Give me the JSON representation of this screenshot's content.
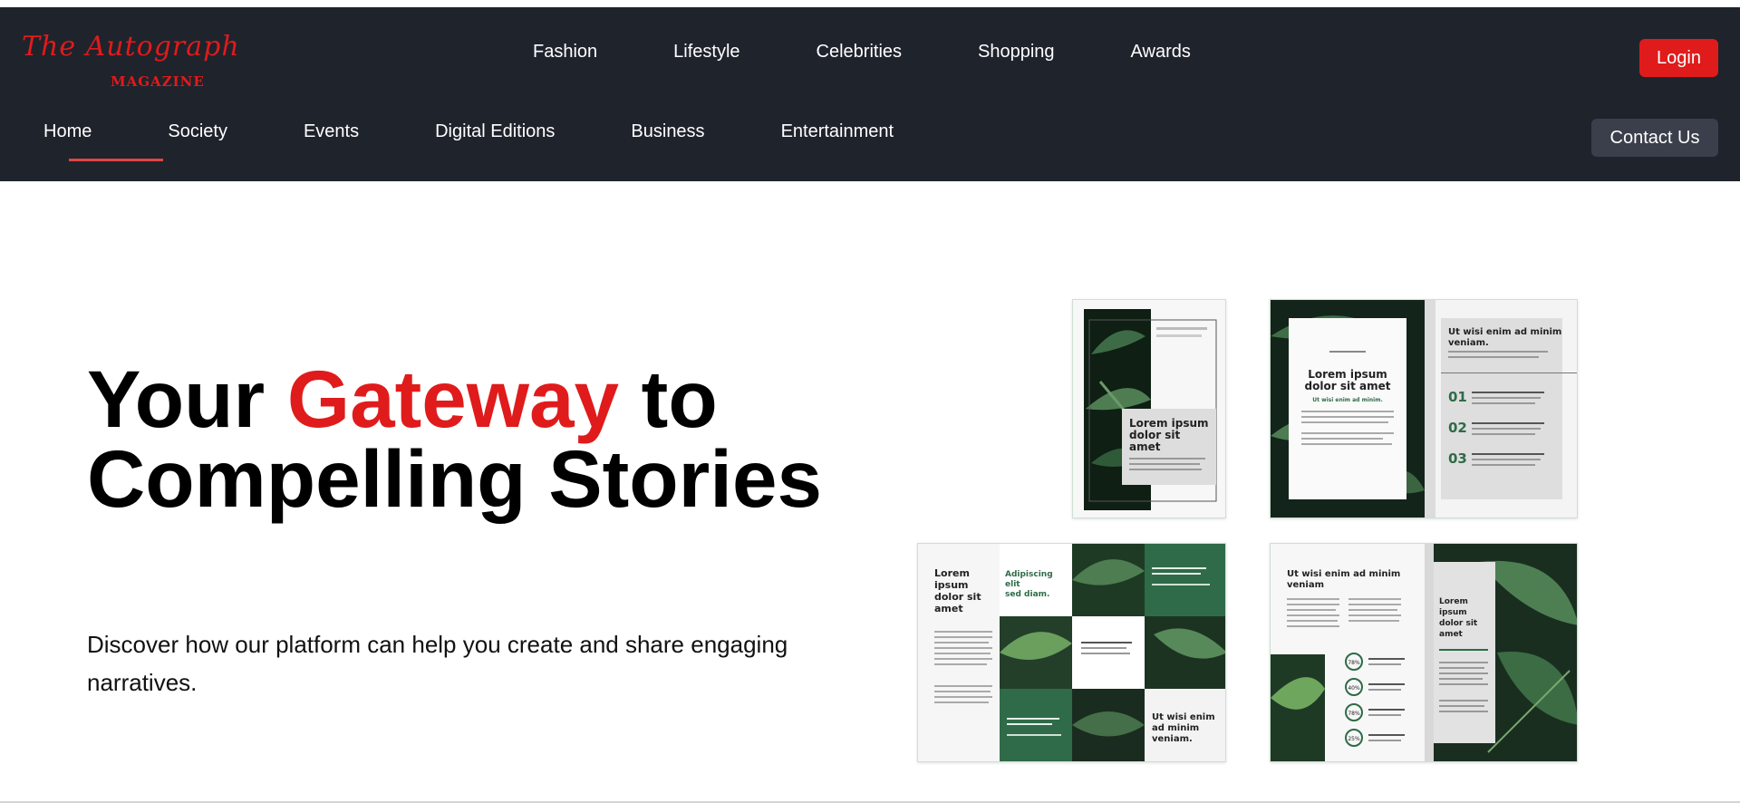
{
  "logo": {
    "script": "The Autograph",
    "sub": "MAGAZINE"
  },
  "top_nav": [
    "Fashion",
    "Lifestyle",
    "Celebrities",
    "Shopping",
    "Awards"
  ],
  "login_label": "Login",
  "sub_nav": [
    "Home",
    "Society",
    "Events",
    "Digital Editions",
    "Business",
    "Entertainment"
  ],
  "active_nav": "Home",
  "contact_label": "Contact Us",
  "hero": {
    "title_pre": "Your ",
    "title_accent": "Gateway",
    "title_post": " to Compelling Stories",
    "description": "Discover how our platform can help you create and share engaging narratives."
  },
  "magazines": {
    "m1_heading": [
      "Lorem ipsum",
      "dolor sit",
      "amet"
    ],
    "m2_left_heading": [
      "Lorem ipsum",
      "dolor sit amet"
    ],
    "m2_left_sub": "Ut wisi enim ad minim.",
    "m2_right_heading": [
      "Ut wisi enim ad minim",
      "veniam."
    ],
    "m2_numbers": [
      "01",
      "02",
      "03"
    ],
    "m3_left_heading": [
      "Lorem",
      "ipsum",
      "dolor sit",
      "amet"
    ],
    "m3_green_heading": [
      "Adipiscing",
      "elit",
      "sed diam."
    ],
    "m3_right_heading": [
      "Ut wisi enim",
      "ad minim",
      "veniam."
    ],
    "m4_heading": [
      "Ut wisi enim ad minim",
      "veniam"
    ],
    "m4_right_heading": [
      "Lorem",
      "ipsum",
      "dolor sit",
      "amet"
    ],
    "m4_percents": [
      "78%",
      "40%",
      "78%",
      "25%"
    ]
  },
  "colors": {
    "header_bg": "#1f232c",
    "accent": "#e01b1b",
    "contact_bg": "#3a3f4b",
    "mag_green": "#2f6b48"
  }
}
